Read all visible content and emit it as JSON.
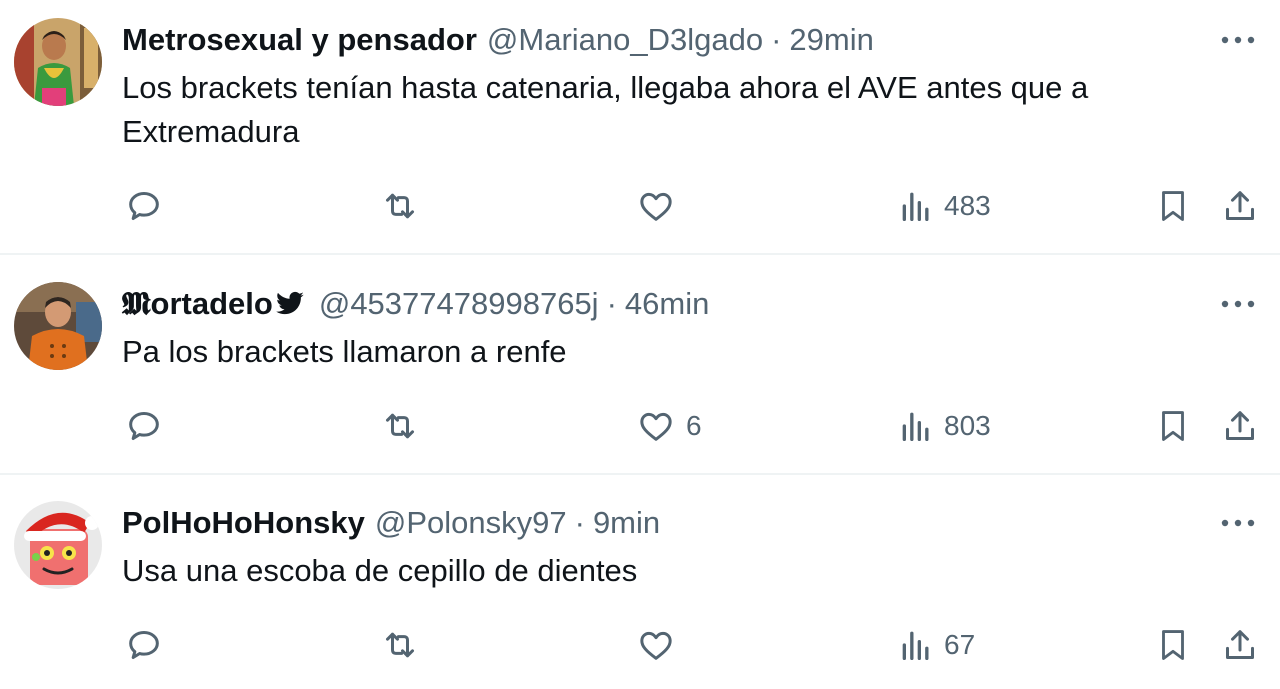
{
  "tweets": [
    {
      "name": "Metrosexual y pensador",
      "handle": "@Mariano_D3lgado",
      "separator": "·",
      "time": "29min",
      "text": "Los brackets tenían hasta catenaria, llegaba ahora el AVE antes que a Extremadura",
      "likes": "",
      "views": "483",
      "avatar_color": "#7a5a3a"
    },
    {
      "name": "𝕸ortadelo",
      "handle": "@45377478998765j",
      "separator": "·",
      "time": "46min",
      "text": "Pa los brackets llamaron a renfe",
      "likes": "6",
      "views": "803",
      "avatar_color": "#b05a2a"
    },
    {
      "name": "PolHoHoHonsky",
      "handle": "@Polonsky97",
      "separator": "·",
      "time": "9min",
      "text": "Usa una escoba de cepillo de dientes",
      "likes": "",
      "views": "67",
      "avatar_color": "#e2565a"
    }
  ],
  "icons": {
    "more": "more-icon",
    "reply": "reply-icon",
    "retweet": "retweet-icon",
    "like": "like-icon",
    "views": "views-icon",
    "bookmark": "bookmark-icon",
    "share": "share-icon",
    "verified_bird": "bird-icon"
  },
  "colors": {
    "text": "#0f1419",
    "secondary": "#536471",
    "divider": "#eff3f4"
  }
}
